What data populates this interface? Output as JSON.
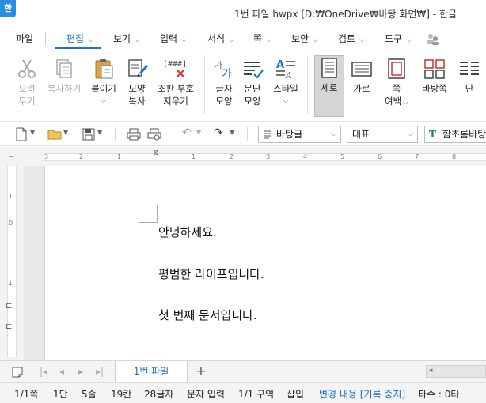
{
  "app": {
    "logo_text": "한",
    "title": "1번 파일.hwpx [D:₩OneDrive₩바탕 화면₩] - 한글"
  },
  "menu": [
    {
      "label": "파일"
    },
    {
      "label": "편집",
      "active": true
    },
    {
      "label": "보기"
    },
    {
      "label": "입력"
    },
    {
      "label": "서식"
    },
    {
      "label": "쪽"
    },
    {
      "label": "보안"
    },
    {
      "label": "검토"
    },
    {
      "label": "도구"
    }
  ],
  "ribbon": {
    "cut": {
      "line1": "오려",
      "line2": "두기"
    },
    "copy": {
      "line1": "복사하기"
    },
    "paste": {
      "line1": "붙이기"
    },
    "format_copy": {
      "line1": "모양",
      "line2": "복사"
    },
    "clear_format": {
      "icon_text": "[###]",
      "line1": "조판 부호",
      "line2": "지우기"
    },
    "char_shape": {
      "line1": "글자",
      "line2": "모양"
    },
    "para_shape": {
      "line1": "문단",
      "line2": "모양"
    },
    "style": {
      "line1": "스타일"
    },
    "portrait": {
      "line1": "세로"
    },
    "landscape": {
      "line1": "가로"
    },
    "page_margin": {
      "line1": "쪽",
      "line2": "여백"
    },
    "page_background": {
      "line1": "바탕쪽"
    },
    "columns": {
      "line1": "단"
    }
  },
  "toolbar": {
    "style_select": "바탕글",
    "lang_select": "대표",
    "font_select": "함초롬바탕"
  },
  "ruler": {
    "h_labels": [
      "3",
      "2",
      "1",
      "1",
      "2",
      "3",
      "4",
      "5",
      "6",
      "7",
      "8"
    ],
    "v_labels": [
      "1",
      "0",
      "1"
    ]
  },
  "document": {
    "paragraphs": [
      "안녕하세요.",
      "평범한 라이프입니다.",
      "첫 번째 문서입니다."
    ]
  },
  "tabs": {
    "active_tab": "1번 파일",
    "add_label": "+"
  },
  "status": {
    "page": "1/1쪽",
    "column": "1단",
    "line": "5줄",
    "char_col": "19칸",
    "char_count": "28글자",
    "input_mode": "문자 입력",
    "section": "1/1 구역",
    "insert_mode": "삽입",
    "track_changes": "변경 내용 [기록 중지]",
    "typing_speed": "타수 : 0타"
  },
  "colors": {
    "accent": "#1a6fd0",
    "logo_bg": "#2a8de0"
  }
}
